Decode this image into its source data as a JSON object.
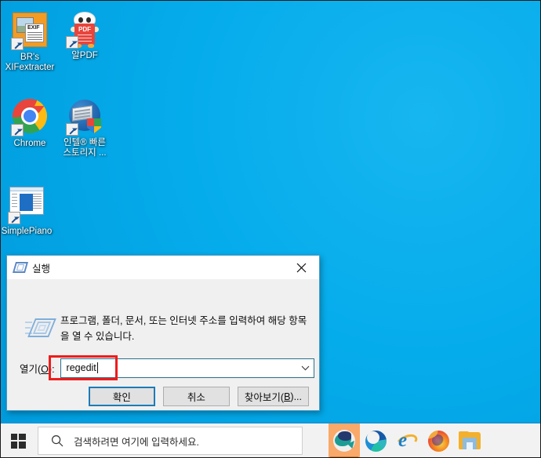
{
  "desktop": {
    "background_color": "#05ACEB",
    "icons": [
      {
        "label": "BR's\nXIFextracter",
        "icon": "exif-extractor-icon",
        "shortcut": true
      },
      {
        "label": "알PDF",
        "icon": "alpdf-icon",
        "shortcut": true
      },
      {
        "label": "Chrome",
        "icon": "chrome-icon",
        "shortcut": true
      },
      {
        "label": "인텔® 빠른\n스토리지 ...",
        "icon": "intel-rapid-storage-icon",
        "shortcut": true
      },
      {
        "label": "SimplePiano",
        "icon": "simplepiano-icon",
        "shortcut": true
      }
    ]
  },
  "run_dialog": {
    "title": "실행",
    "title_icon": "run-window-icon",
    "close_label": "✕",
    "description": "프로그램, 폴더, 문서, 또는 인터넷 주소를 입력하여 해당 항목을 열 수 있습니다.",
    "open_label_prefix": "열기(",
    "open_label_accel": "O",
    "open_label_suffix": "):",
    "input_value": "regedit",
    "input_placeholder": "",
    "dropdown_icon": "chevron-down-icon",
    "buttons": {
      "ok": "확인",
      "cancel": "취소",
      "browse_prefix": "찾아보기(",
      "browse_accel": "B",
      "browse_suffix": ")..."
    },
    "annotation": {
      "type": "rectangle-highlight",
      "color": "#EE1C1C"
    }
  },
  "taskbar": {
    "start_icon": "windows-start-icon",
    "search": {
      "icon": "search-icon",
      "placeholder": "검색하려면 여기에 입력하세요."
    },
    "pinned": [
      {
        "name": "whale-browser-icon",
        "label": "Whale",
        "active": true
      },
      {
        "name": "microsoft-edge-icon",
        "label": "Microsoft Edge",
        "active": false
      },
      {
        "name": "internet-explorer-icon",
        "label": "Internet Explorer",
        "active": false
      },
      {
        "name": "firefox-icon",
        "label": "Firefox",
        "active": false
      },
      {
        "name": "file-explorer-icon",
        "label": "File Explorer",
        "active": false
      }
    ]
  }
}
